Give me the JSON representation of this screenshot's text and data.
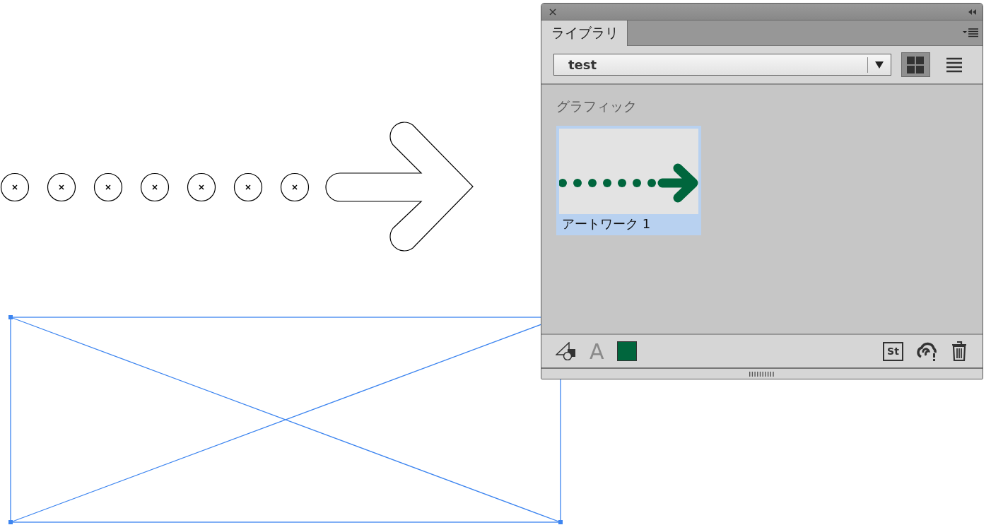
{
  "panel": {
    "tab": {
      "label": "ライブラリ",
      "selected": true
    },
    "library_select": {
      "value": "test"
    },
    "view_buttons": [
      {
        "kind": "grid",
        "selected": true
      },
      {
        "kind": "list",
        "selected": false
      }
    ],
    "section_title": "グラフィック",
    "items": [
      {
        "label": "アートワーク 1",
        "selected": true
      }
    ],
    "footer": {
      "text_button": "A",
      "stock_button": "St",
      "swatch": {
        "color": "#00663d"
      }
    }
  }
}
